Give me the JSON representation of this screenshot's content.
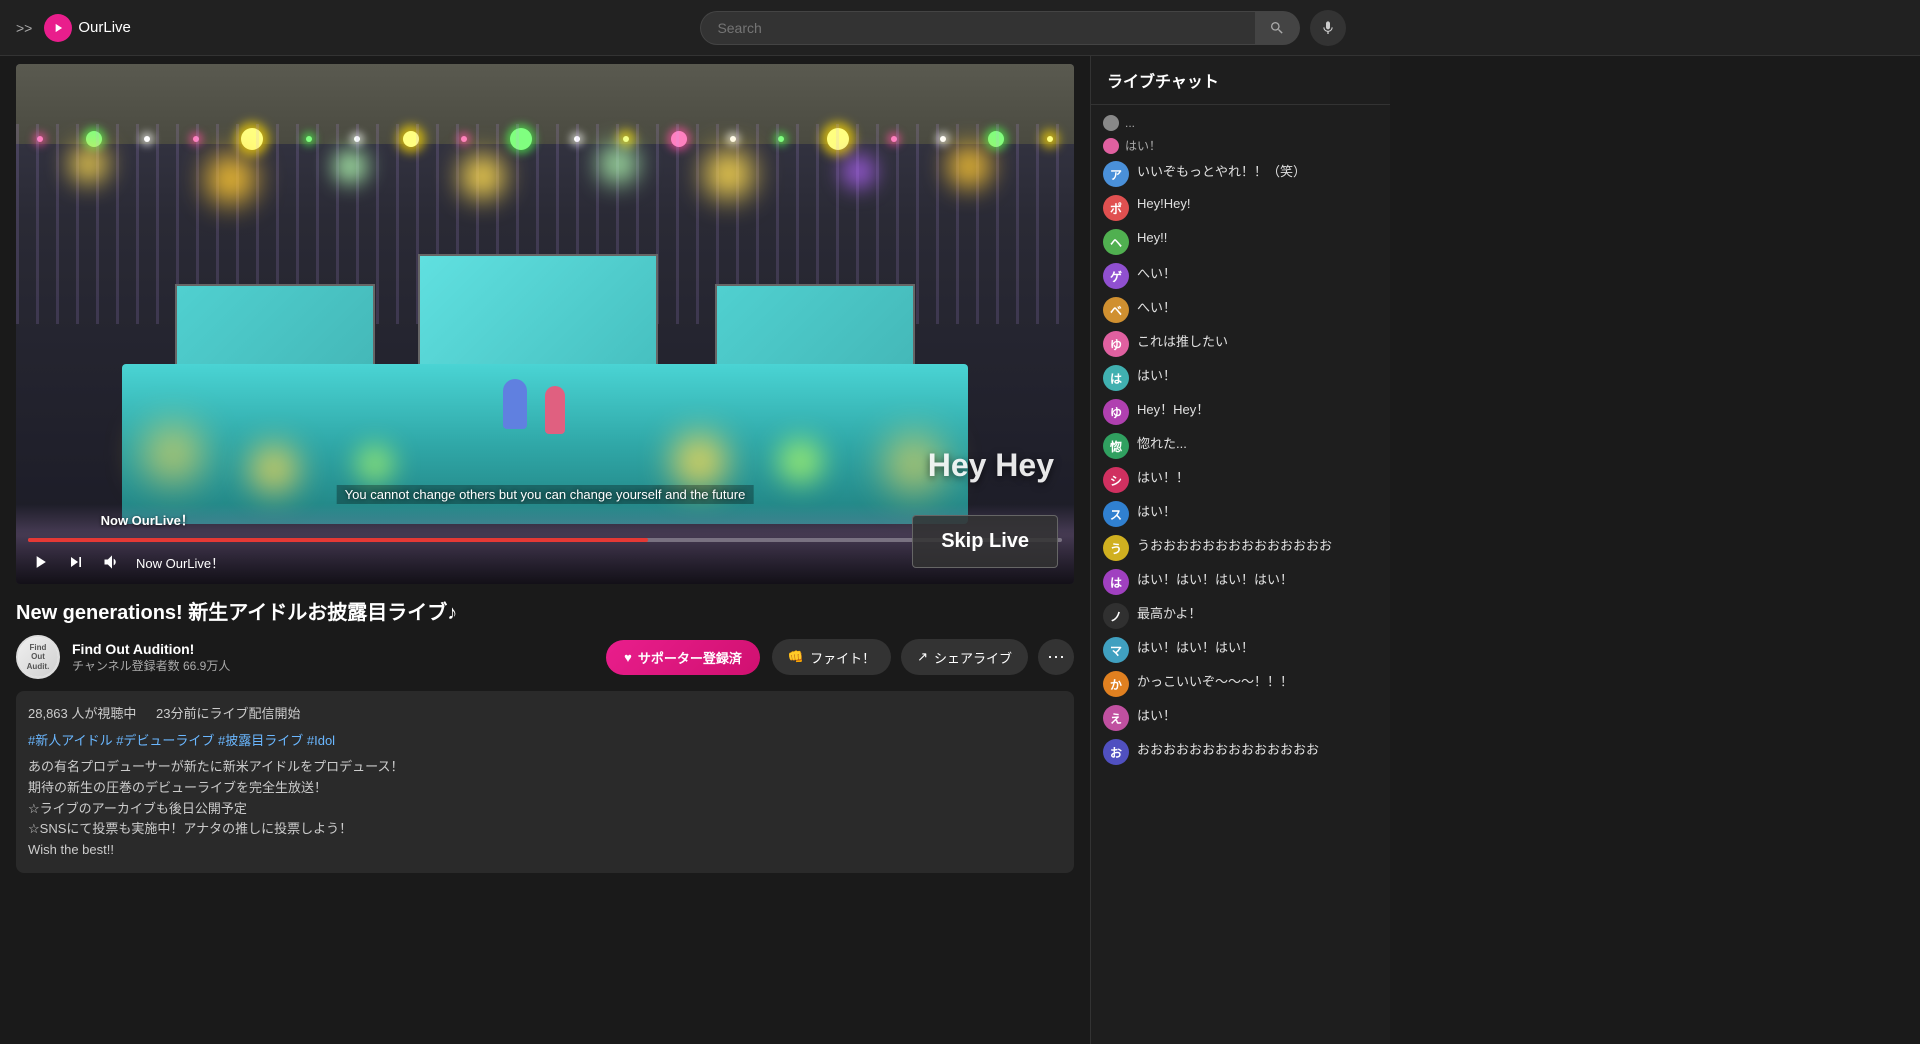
{
  "header": {
    "nav_arrows": ">>",
    "logo_text": "OurLive",
    "search_placeholder": "Search"
  },
  "video": {
    "title": "New generations! 新生アイドルお披露目ライブ♪",
    "subtitle": "You cannot change others but you can change yourself and the future",
    "now_playing": "Now OurLive！",
    "progress_percent": 60,
    "channel": {
      "name": "Find Out Audition!",
      "subs": "チャンネル登録者数 66.9万人",
      "avatar_text": "Find\nOut\nAudition"
    },
    "support_btn": "サポーター登録済",
    "action_fight": "ファイト！",
    "action_share": "シェアライブ",
    "stats": "28,863 人が視聴中",
    "time_ago": "23分前にライブ配信開始",
    "tags": "#新人アイドル #デビューライブ #披露目ライブ #Idol",
    "description": "あの有名プロデューサーが新たに新米アイドルをプロデュース！\n期待の新生の圧巻のデビューライブを完全生放送！\n☆ライブのアーカイブも後日公開予定\n☆SNSにて投票も実施中！アナタの推しに投票しよう！\nWish the best!!",
    "skip_live_btn": "Skip Live",
    "hey_hey_overlay": "Hey Hey"
  },
  "chat": {
    "header": "ライブチャット",
    "messages": [
      {
        "avatar_color": "#4a90d9",
        "avatar_letter": "ア",
        "username": "",
        "text": "いいぞもっとやれ！！（笑）",
        "type": "normal"
      },
      {
        "avatar_color": "#e05050",
        "avatar_letter": "ポ",
        "username": "",
        "text": "Hey!Hey!",
        "type": "normal"
      },
      {
        "avatar_color": "#50b050",
        "avatar_letter": "ヘ",
        "username": "",
        "text": "Hey!!",
        "type": "normal"
      },
      {
        "avatar_color": "#9050d0",
        "avatar_letter": "ゲ",
        "username": "",
        "text": "へい！",
        "type": "normal"
      },
      {
        "avatar_color": "#d09030",
        "avatar_letter": "ベ",
        "username": "",
        "text": "へい！",
        "type": "normal"
      },
      {
        "avatar_color": "#e060a0",
        "avatar_letter": "ゆ",
        "username": "",
        "text": "これは推したい",
        "type": "normal"
      },
      {
        "avatar_color": "#40b0b0",
        "avatar_letter": "は",
        "username": "",
        "text": "はい！",
        "type": "normal"
      },
      {
        "avatar_color": "#b040b0",
        "avatar_letter": "ゆ",
        "username": "",
        "text": "Hey！Hey！",
        "type": "normal"
      },
      {
        "avatar_color": "#30a060",
        "avatar_letter": "惚",
        "username": "",
        "text": "惚れた...",
        "type": "normal"
      },
      {
        "avatar_color": "#d03060",
        "avatar_letter": "シ",
        "username": "",
        "text": "はい！！",
        "type": "normal"
      },
      {
        "avatar_color": "#3080d0",
        "avatar_letter": "ス",
        "username": "",
        "text": "はい！",
        "type": "normal"
      },
      {
        "avatar_color": "#d0b020",
        "avatar_letter": "う",
        "username": "",
        "text": "うおおおおおおおおおおおおおお",
        "type": "normal"
      },
      {
        "avatar_color": "#a040c0",
        "avatar_letter": "は",
        "username": "",
        "text": "はい！はい！はい！はい！",
        "type": "normal"
      },
      {
        "avatar_color": "#303030",
        "avatar_letter": "ノ",
        "username": "",
        "text": "最高かよ！",
        "type": "normal"
      },
      {
        "avatar_color": "#40a0c0",
        "avatar_letter": "マ",
        "username": "",
        "text": "はい！はい！はい！",
        "type": "normal"
      },
      {
        "avatar_color": "#e08020",
        "avatar_letter": "か",
        "username": "",
        "text": "かっこいいぞ〜〜〜！！！",
        "type": "normal"
      },
      {
        "avatar_color": "#c050a0",
        "avatar_letter": "え",
        "username": "",
        "text": "はい！",
        "type": "normal"
      },
      {
        "avatar_color": "#5050c0",
        "avatar_letter": "お",
        "username": "",
        "text": "おおおおおおおおおおおおおお",
        "type": "normal"
      }
    ],
    "dot_messages": [
      {
        "color": "#888",
        "text": "..."
      },
      {
        "color": "#e060a0",
        "text": "はい！"
      }
    ]
  }
}
